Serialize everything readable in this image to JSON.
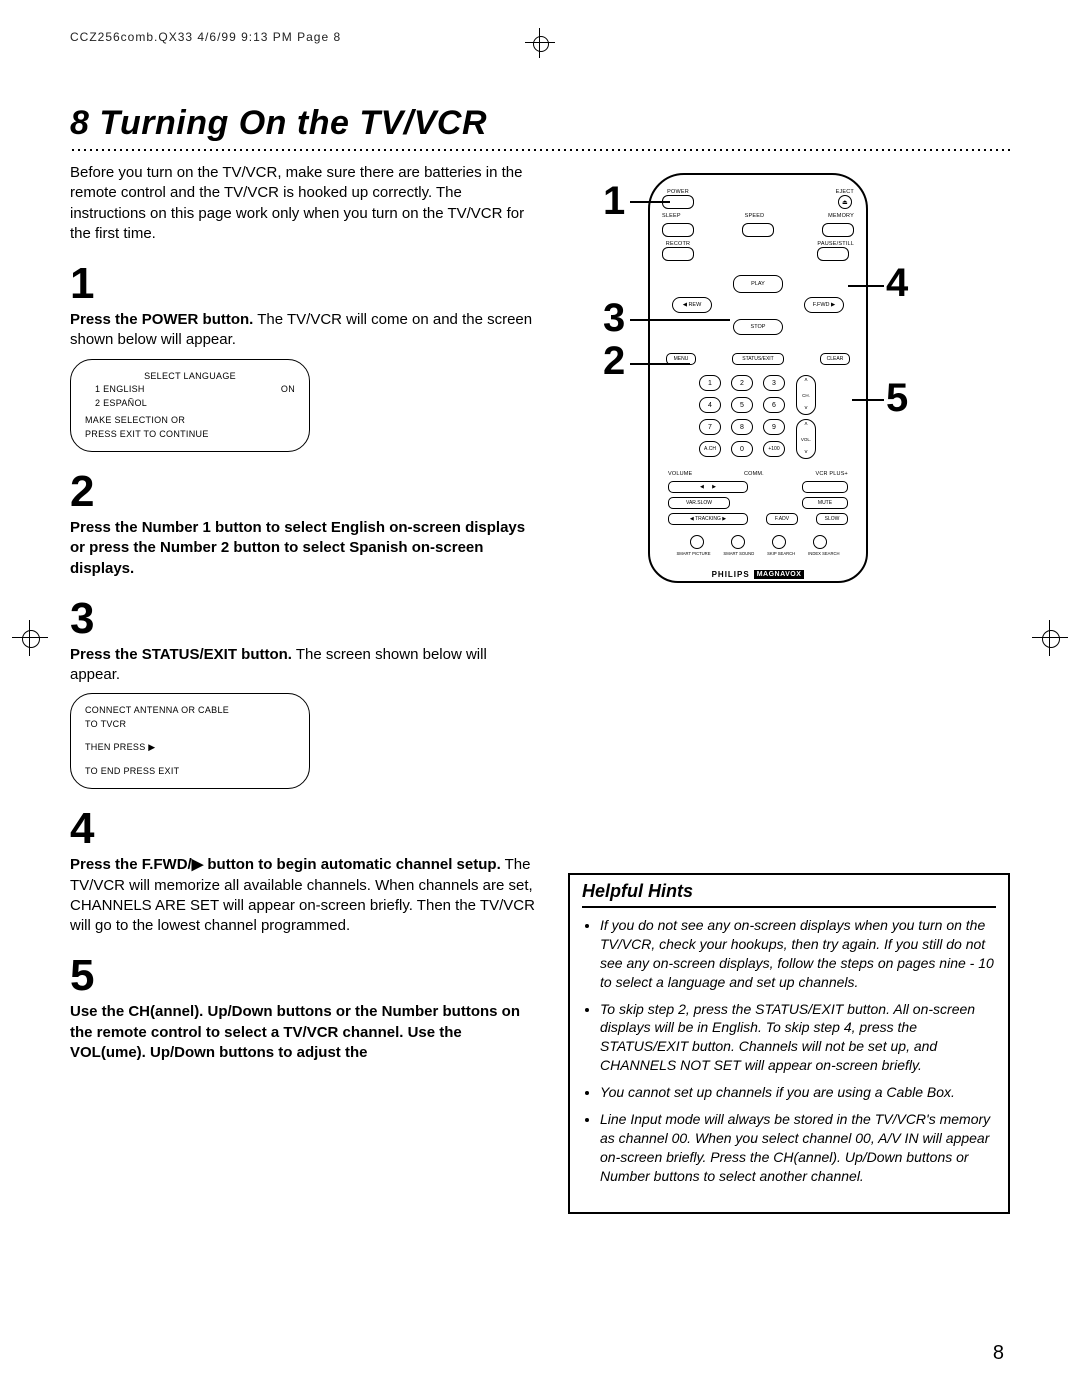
{
  "print_header": "CCZ256comb.QX33  4/6/99 9:13 PM  Page 8",
  "title": "8  Turning On the TV/VCR",
  "intro": "Before you turn on the TV/VCR, make sure there are batteries in the remote control and the TV/VCR is hooked up correctly. The instructions on this page work only when you turn on the TV/VCR for the first time.",
  "steps": {
    "s1": {
      "num": "1",
      "bold": "Press the POWER button.",
      "rest": " The TV/VCR will come on and the screen shown below will appear."
    },
    "s2": {
      "num": "2",
      "bold": "Press the Number 1 button to select English on-screen displays or press the Number 2 button to select Spanish on-screen displays."
    },
    "s3": {
      "num": "3",
      "bold": "Press the STATUS/EXIT button.",
      "rest": " The screen shown below will appear."
    },
    "s4": {
      "num": "4",
      "bold": "Press the F.FWD/▶ button to begin automatic channel setup.",
      "rest": " The TV/VCR will memorize all available channels. When channels are set, CHANNELS ARE SET will appear on-screen briefly. Then the TV/VCR will go to the lowest channel programmed."
    },
    "s5": {
      "num": "5",
      "bold": "Use the CH(annel). Up/Down buttons or the Number buttons on the remote control to select a TV/VCR channel. Use the VOL(ume). Up/Down buttons to adjust the"
    }
  },
  "osd1": {
    "title": "SELECT LANGUAGE",
    "line1_left": "1 ENGLISH",
    "line1_right": "ON",
    "line2": "2 ESPAÑOL",
    "footer": "MAKE SELECTION OR\nPRESS EXIT TO CONTINUE"
  },
  "osd2": {
    "line1": "CONNECT ANTENNA OR CABLE",
    "line2": "TO TVCR",
    "line3": "THEN PRESS ▶",
    "line4": "TO END PRESS EXIT"
  },
  "remote": {
    "power": "POWER",
    "eject": "EJECT",
    "sleep": "SLEEP",
    "speed": "SPEED",
    "memory": "MEMORY",
    "record": "RECOTR",
    "pause": "PAUSE/STILL",
    "play": "PLAY",
    "rew": "REW",
    "ffwd": "F.FWD",
    "stop": "STOP",
    "menu": "MENU",
    "status": "STATUS/EXIT",
    "clear": "CLEAR",
    "keys": [
      "1",
      "2",
      "3",
      "4",
      "5",
      "6",
      "7",
      "8",
      "9",
      "A.CH",
      "0",
      "+100"
    ],
    "ch": "CH.",
    "vol": "VOL.",
    "volume_label": "VOLUME",
    "vcrplus": "VCR PLUS+",
    "comm": "COMM.",
    "varslow": "VAR.SLOW",
    "mute": "MUTE",
    "tracking": "TRACKING",
    "fadv": "F.ADV",
    "slow": "SLOW",
    "btm_labels": [
      "SMART PICTURE",
      "SMART SOUND",
      "SKIP SEARCH",
      "INDEX SEARCH"
    ],
    "brand1": "PHILIPS",
    "brand2": "MAGNAVOX"
  },
  "callouts": {
    "c1": "1",
    "c2": "2",
    "c3": "3",
    "c4": "4",
    "c5": "5"
  },
  "hints": {
    "header": "Helpful Hints",
    "items": [
      "If you do not see any on-screen displays when you turn on the TV/VCR, check your hookups, then try again. If you still do not see any on-screen displays, follow the steps on pages nine - 10 to select a language and set up channels.",
      "To skip step 2, press the STATUS/EXIT button. All on-screen displays will be in English. To skip step 4, press the STATUS/EXIT button. Channels will not be set up, and CHANNELS NOT SET will appear on-screen briefly.",
      "You cannot set up channels if you are using a Cable Box.",
      "Line Input mode will always be stored in the TV/VCR's memory as channel 00. When you select channel 00, A/V IN will appear on-screen briefly. Press the CH(annel). Up/Down buttons or Number buttons to select another channel."
    ]
  },
  "page_number": "8"
}
